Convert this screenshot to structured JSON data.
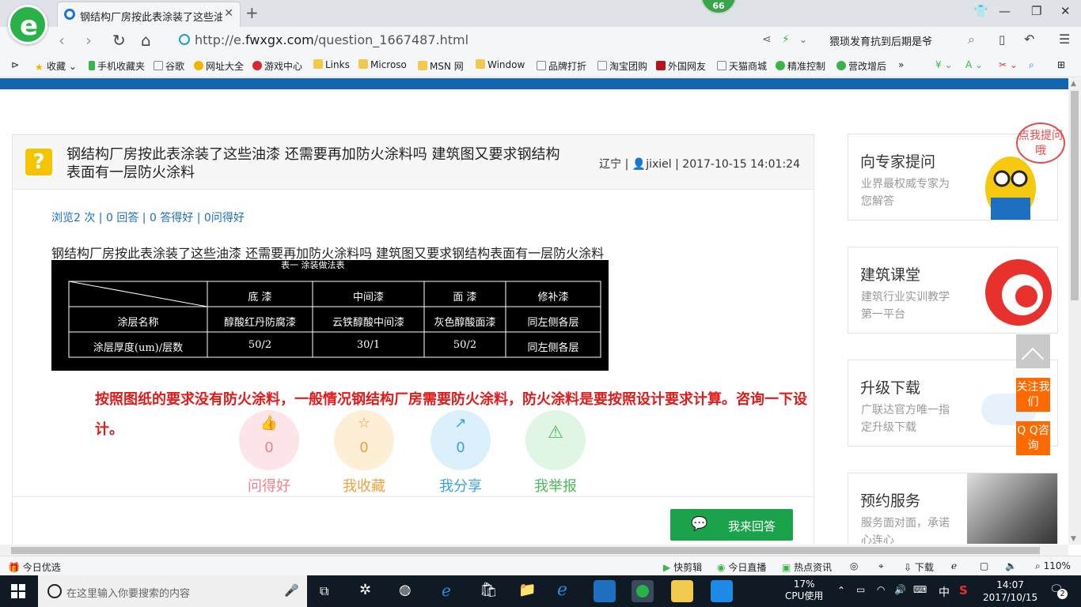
{
  "browser": {
    "tab_title": "钢结构厂房按此表涂装了这些油漆",
    "badge_count": "66",
    "url_prefix": "http://e.",
    "url_domain": "fwxgx.com",
    "url_path": "/question_1667487.html",
    "search_text": "猥琐发育抗到后期是爷",
    "bookmarks": [
      "收藏",
      "手机收藏夹",
      "谷歌",
      "网址大全",
      "游戏中心",
      "Links",
      "Microso",
      "MSN 网",
      "Window",
      "品牌打折",
      "淘宝团购",
      "外国网友",
      "天猫商城",
      "精准控制",
      "营改增后"
    ]
  },
  "question": {
    "title": "钢结构厂房按此表涂装了这些油漆 还需要再加防火涂料吗 建筑图又要求钢结构表面有一层防火涂料",
    "region": "辽宁",
    "user": "jixiel",
    "time": "2017-10-15 14:01:24",
    "stats": "浏览2 次 | 0 回答 | 0 答得好 | 0问得好",
    "body": "钢结构厂房按此表涂装了这些油漆 还需要再加防火涂料吗 建筑图又要求钢结构表面有一层防火涂料",
    "table": {
      "caption": "表一  涂装做法表",
      "headers": [
        "底  漆",
        "中间漆",
        "面  漆",
        "修补漆"
      ],
      "rows": [
        {
          "label": "涂层名称",
          "cells": [
            "醇酸红丹防腐漆",
            "云铁醇酸中间漆",
            "灰色醇酸面漆",
            "同左侧各层"
          ]
        },
        {
          "label": "涂层厚度(um)/层数",
          "cells": [
            "50/2",
            "30/1",
            "50/2",
            "同左侧各层"
          ]
        }
      ]
    },
    "answer": "按照图纸的要求没有防火涂料，一般情况钢结构厂房需要防火涂料，防火涂料是要按照设计要求计算。咨询一下设计。",
    "actions": [
      {
        "label": "问得好",
        "count": "0",
        "color": "#f07f8d",
        "bg": "#fde4e8"
      },
      {
        "label": "我收藏",
        "count": "0",
        "color": "#e8a33c",
        "bg": "#fdefd6"
      },
      {
        "label": "我分享",
        "count": "0",
        "color": "#3ca0e0",
        "bg": "#dcf0fc"
      },
      {
        "label": "我举报",
        "count": "",
        "color": "#4cb85a",
        "bg": "#e0f5e3"
      }
    ],
    "reply_label": "我来回答"
  },
  "sidebar": {
    "cards": [
      {
        "title": "向专家提问",
        "sub": "业界最权威专家为您解答"
      },
      {
        "title": "建筑课堂",
        "sub": "建筑行业实训教学第一平台"
      },
      {
        "title": "升级下载",
        "sub": "广联达官方唯一指定升级下载"
      },
      {
        "title": "预约服务",
        "sub": "服务面对面，承诺心连心"
      }
    ],
    "bubble": "点我提问哦"
  },
  "float": {
    "follow": "关注我们",
    "qq": "Q Q咨询"
  },
  "statusbar": {
    "left": "今日优选",
    "items": [
      "快剪辑",
      "今日直播",
      "热点资讯",
      "下载"
    ],
    "zoom": "110%"
  },
  "taskbar": {
    "search_placeholder": "在这里输入你要搜索的内容",
    "cpu_pct": "17%",
    "cpu_label": "CPU使用",
    "ime": "中",
    "time": "14:07",
    "date": "2017/10/15",
    "notif": "2"
  }
}
